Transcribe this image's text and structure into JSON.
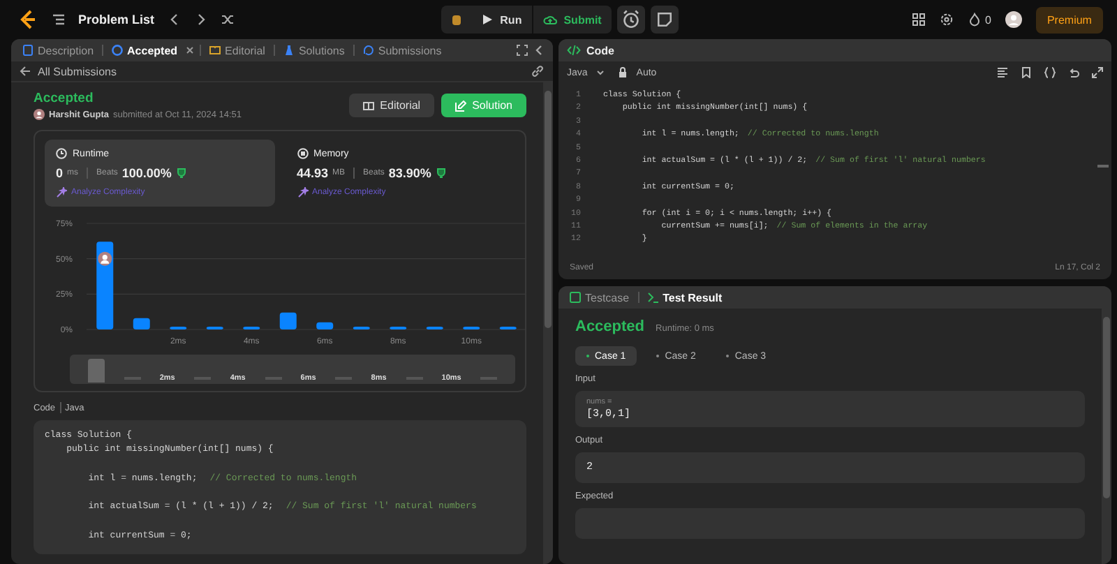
{
  "topbar": {
    "title": "Problem List",
    "run": "Run",
    "submit": "Submit",
    "streak": "0",
    "premium": "Premium"
  },
  "left_tabs": [
    {
      "label": "Description",
      "kind": "description",
      "selected": false,
      "closable": false
    },
    {
      "label": "Accepted",
      "kind": "accepted",
      "selected": true,
      "closable": true
    },
    {
      "label": "Editorial",
      "kind": "editorial",
      "selected": false,
      "closable": false
    },
    {
      "label": "Solutions",
      "kind": "solutions",
      "selected": false,
      "closable": false
    },
    {
      "label": "Submissions",
      "kind": "submissions",
      "selected": false,
      "closable": false
    }
  ],
  "back_link": "All Submissions",
  "submission": {
    "status": "Accepted",
    "user": "Harshit Gupta",
    "submitted": "submitted at Oct 11, 2024 14:51",
    "editorial_button": "Editorial",
    "solution_button": "Solution"
  },
  "stats": [
    {
      "kind": "runtime",
      "title": "Runtime",
      "value": "0",
      "unit": "ms",
      "beats_label": "Beats",
      "beats": "100.00%",
      "analyze": "Analyze Complexity",
      "selected": true
    },
    {
      "kind": "memory",
      "title": "Memory",
      "value": "44.93",
      "unit": "MB",
      "beats_label": "Beats",
      "beats": "83.90%",
      "analyze": "Analyze Complexity",
      "selected": false
    }
  ],
  "chart_data": {
    "type": "bar",
    "x": [
      0,
      1,
      2,
      3,
      4,
      5,
      6,
      7,
      8,
      9,
      10,
      11
    ],
    "values": [
      62,
      8,
      2,
      2,
      2,
      12,
      5,
      2,
      2,
      2,
      2,
      2
    ],
    "xlim": [
      -0.5,
      11.5
    ],
    "ylim": [
      0,
      75
    ],
    "yticks": [
      {
        "value": 0,
        "label": "0%"
      },
      {
        "value": 25,
        "label": "25%"
      },
      {
        "value": 50,
        "label": "50%"
      },
      {
        "value": 75,
        "label": "75%"
      }
    ],
    "xticks": [
      {
        "value": 2,
        "label": "2ms"
      },
      {
        "value": 4,
        "label": "4ms"
      },
      {
        "value": 6,
        "label": "6ms"
      },
      {
        "value": 8,
        "label": "8ms"
      },
      {
        "value": 10,
        "label": "10ms"
      }
    ]
  },
  "overview_labels": [
    "2ms",
    "4ms",
    "6ms",
    "8ms",
    "10ms"
  ],
  "code_view": {
    "label": "Code",
    "language": "Java",
    "lines": [
      {
        "code": "class Solution {"
      },
      {
        "code": "    public int missingNumber(int[] nums) {"
      },
      {
        "code": "        int l = nums.length;",
        "comment": "// Corrected to nums.length",
        "blank_before": true
      },
      {
        "code": "        int actualSum = (l * (l + 1)) / 2;",
        "comment": "// Sum of first 'l' natural numbers",
        "blank_before": true
      },
      {
        "code": "        int currentSum = 0;",
        "blank_before": true
      }
    ]
  },
  "editor": {
    "title": "Code",
    "language": "Java",
    "mode": "Auto",
    "status": "Saved",
    "cursor": "Ln 17, Col 2",
    "lines": [
      {
        "number": "1",
        "code": "class Solution {"
      },
      {
        "number": "2",
        "code": "    public int missingNumber(int[] nums) {"
      },
      {
        "number": "3"
      },
      {
        "number": "4",
        "code": "        int l = nums.length;",
        "comment": "// Corrected to nums.length"
      },
      {
        "number": "5"
      },
      {
        "number": "6",
        "code": "        int actualSum = (l * (l + 1)) / 2;",
        "comment": "// Sum of first 'l' natural numbers"
      },
      {
        "number": "7"
      },
      {
        "number": "8",
        "code": "        int currentSum = 0;"
      },
      {
        "number": "9"
      },
      {
        "number": "10",
        "code": "        for (int i = 0; i < nums.length; i++) {"
      },
      {
        "number": "11",
        "code": "            currentSum += nums[i];",
        "comment": "// Sum of elements in the array"
      },
      {
        "number": "12",
        "code": "        }"
      }
    ]
  },
  "result": {
    "tabs": [
      {
        "label": "Testcase",
        "kind": "testcase",
        "selected": false
      },
      {
        "label": "Test Result",
        "kind": "result",
        "selected": true
      }
    ],
    "status": "Accepted",
    "runtime": "Runtime: 0 ms",
    "cases": [
      {
        "label": "Case 1",
        "selected": true
      },
      {
        "label": "Case 2",
        "selected": false
      },
      {
        "label": "Case 3",
        "selected": false
      }
    ],
    "sections": [
      {
        "label": "Input",
        "var": "nums =",
        "value": "[3,0,1]"
      },
      {
        "label": "Output",
        "value": "2"
      },
      {
        "label": "Expected"
      }
    ]
  }
}
